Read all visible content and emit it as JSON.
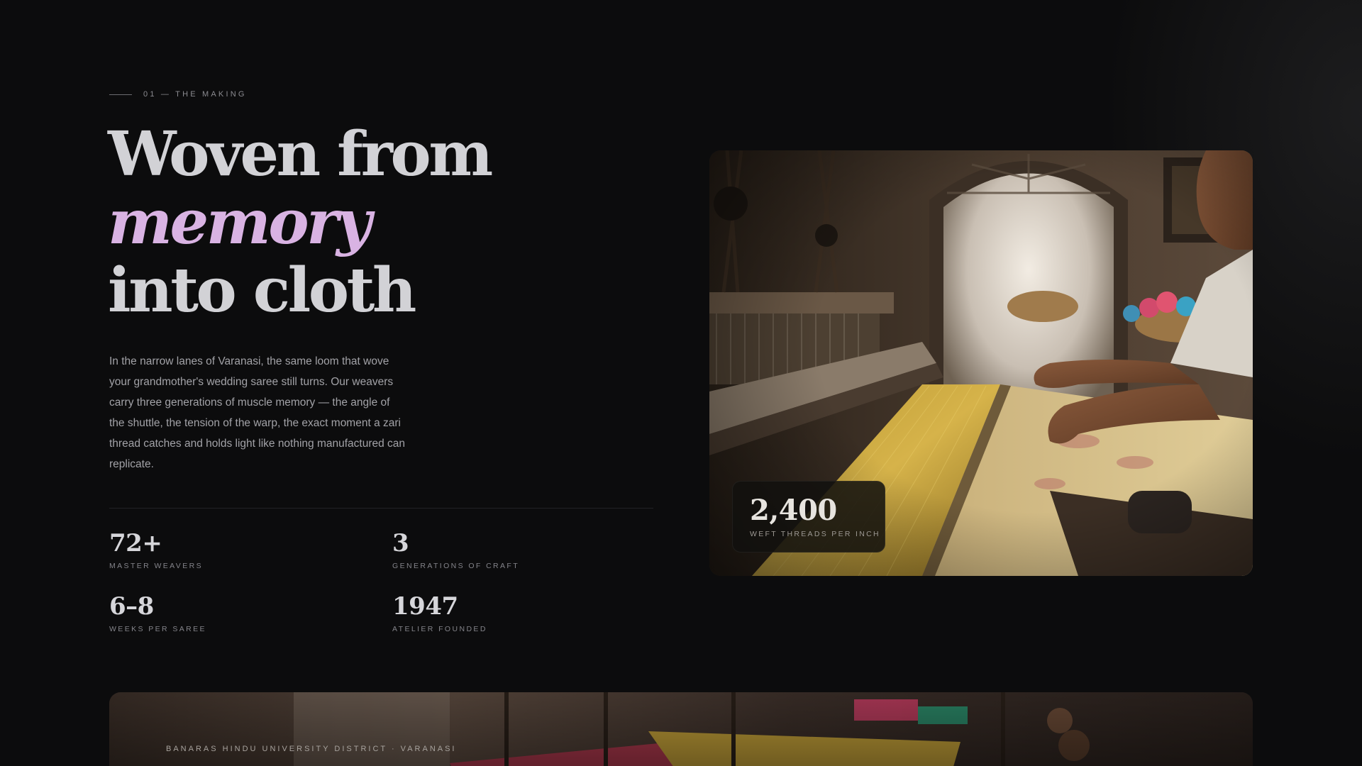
{
  "section": {
    "eyebrow": "01 — THE MAKING"
  },
  "headline": {
    "line1": "Woven from",
    "line2_accent": "memory",
    "line3": "into cloth"
  },
  "body": {
    "paragraph": "In the narrow lanes of Varanasi, the same loom that wove your grandmother's wedding saree still turns. Our weavers carry three generations of muscle memory — the angle of the shuttle, the tension of the warp, the exact moment a zari thread catches and holds light like nothing manufactured can replicate."
  },
  "stats": [
    {
      "value": "72+",
      "label": "MASTER WEAVERS"
    },
    {
      "value": "3",
      "label": "GENERATIONS OF CRAFT"
    },
    {
      "value": "6–8",
      "label": "WEEKS PER SAREE"
    },
    {
      "value": "1947",
      "label": "ATELIER FOUNDED"
    }
  ],
  "photo_card": {
    "value": "2,400",
    "label": "WEFT THREADS PER INCH"
  },
  "panorama": {
    "caption": "BANARAS HINDU UNIVERSITY DISTRICT · VARANASI"
  },
  "colors": {
    "background": "#0c0c0d",
    "headline": "#d2d2d6",
    "accent": "#d9b3e3",
    "muted_text": "#a2a2a7"
  }
}
